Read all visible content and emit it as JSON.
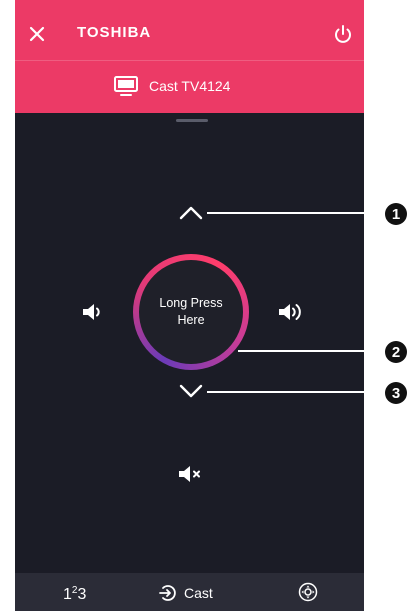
{
  "header": {
    "brand": "TOSHIBA",
    "cast_target": "Cast TV4124",
    "accent_color": "#ec3a66"
  },
  "remote": {
    "dial_line1": "Long Press",
    "dial_line2": "Here",
    "icons": {
      "up": "chevron-up-icon",
      "down": "chevron-down-icon",
      "vol_down": "volume-down-icon",
      "vol_up": "volume-up-icon",
      "mute": "mute-icon"
    }
  },
  "bottom_bar": {
    "keypad_1": "1",
    "keypad_2": "2",
    "keypad_3": "3",
    "cast_label": "Cast"
  },
  "callouts": [
    "1",
    "2",
    "3"
  ]
}
